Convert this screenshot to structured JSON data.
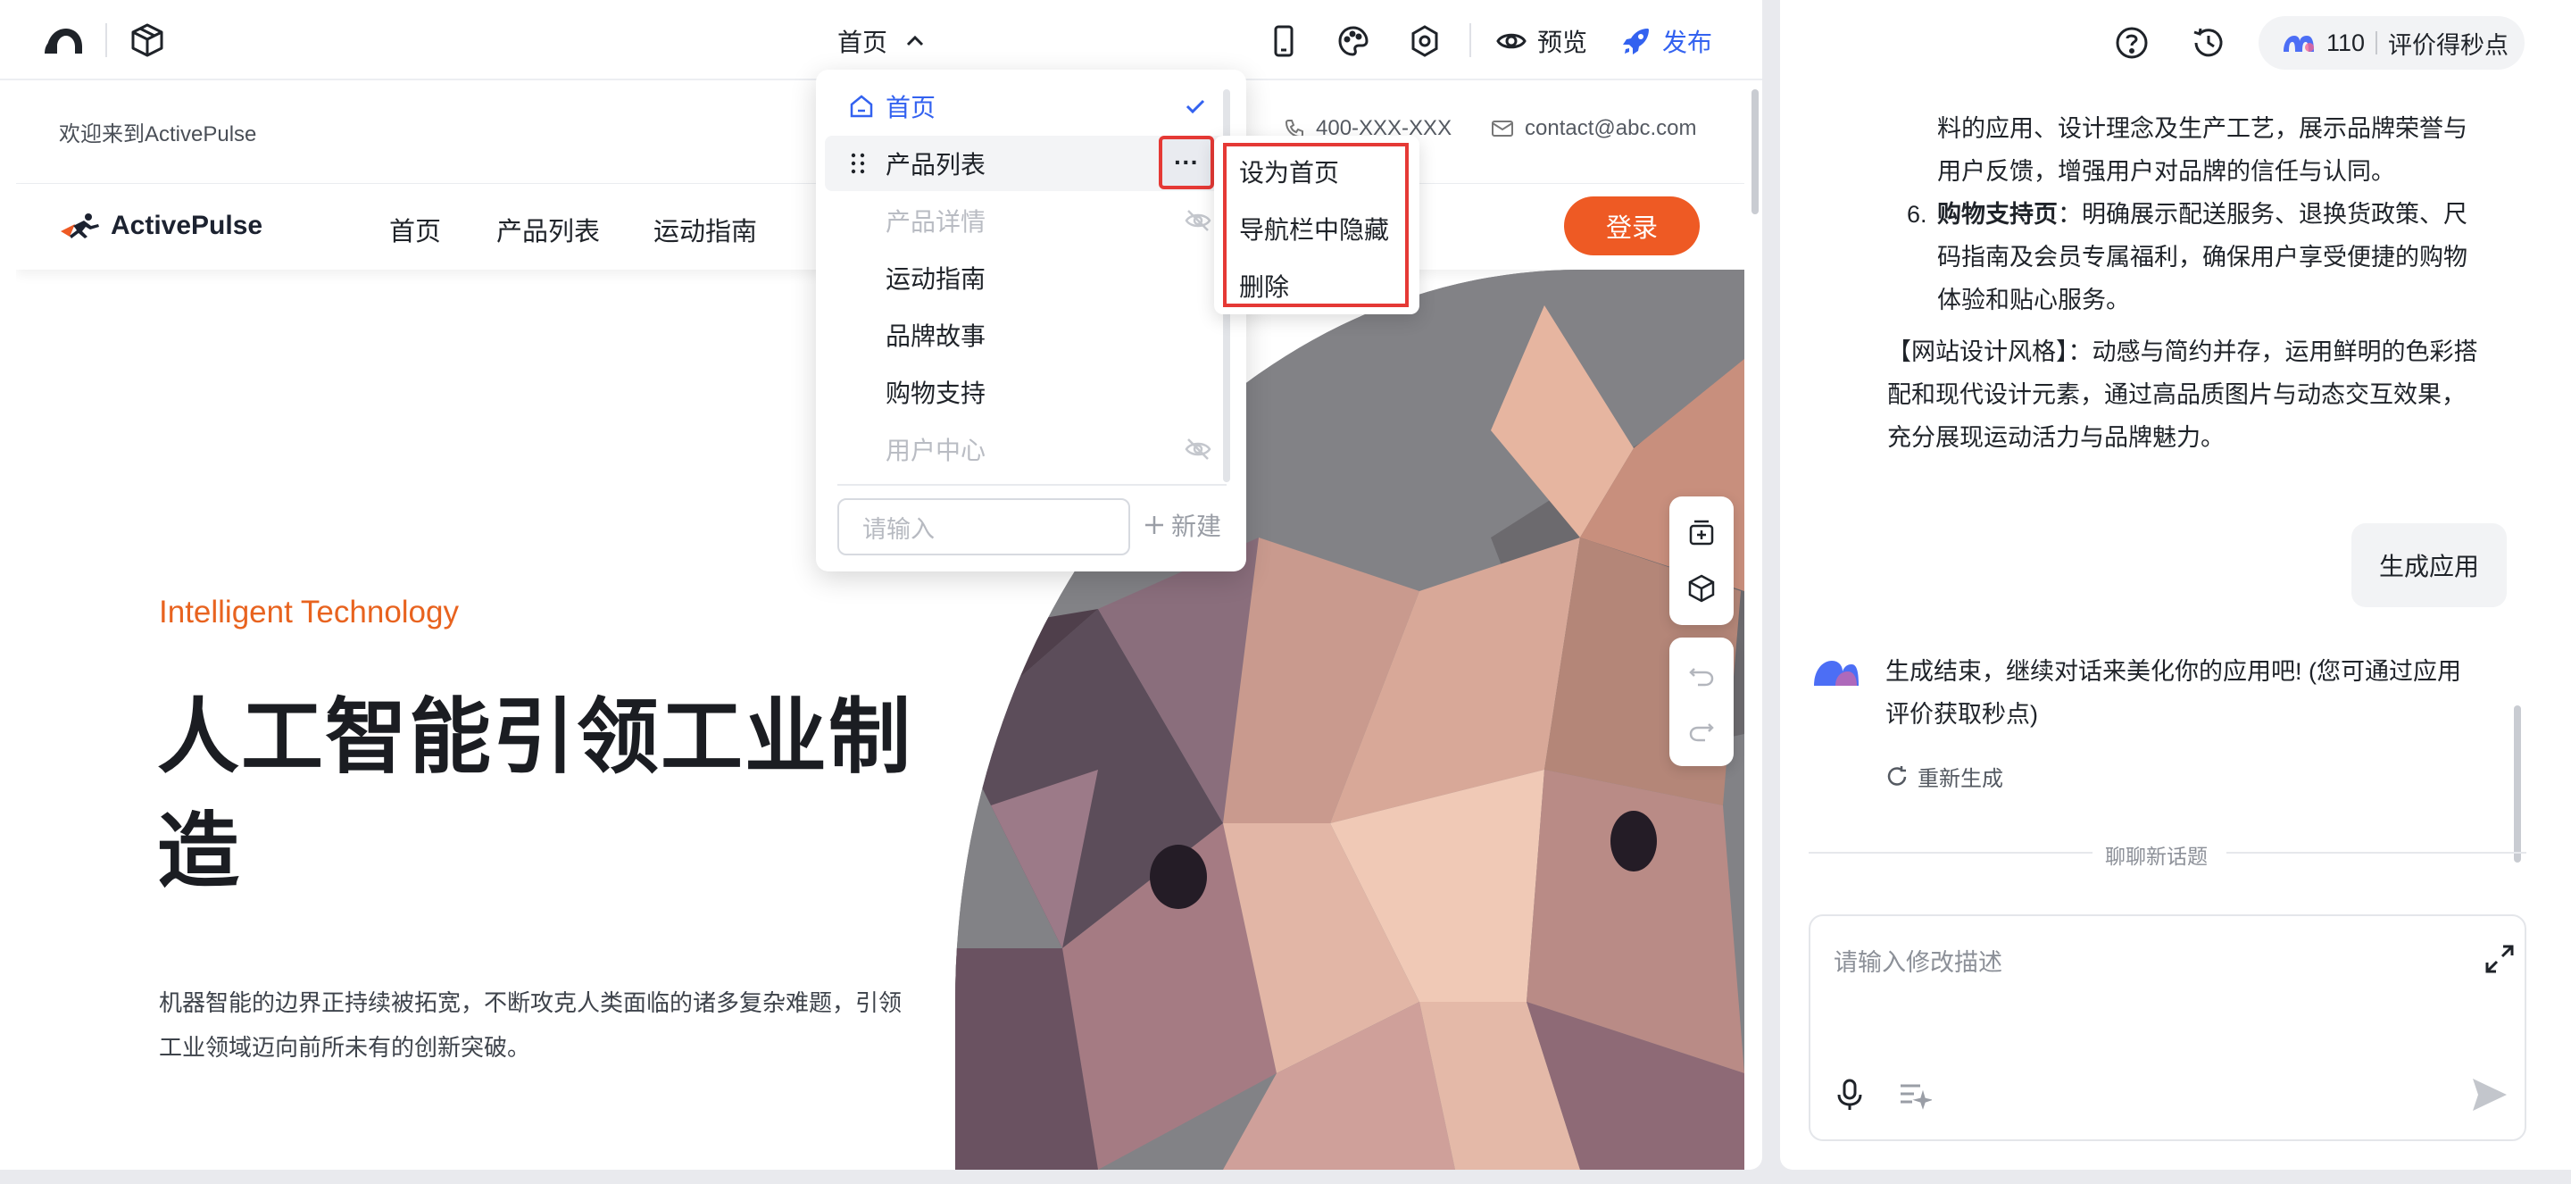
{
  "topbar": {
    "current_page": "首页",
    "preview_label": "预览",
    "publish_label": "发布"
  },
  "site": {
    "welcome": "欢迎来到ActivePulse",
    "phone": "400-XXX-XXX",
    "email": "contact@abc.com",
    "brand": "ActivePulse",
    "nav": [
      "首页",
      "产品列表",
      "运动指南"
    ],
    "login": "登录",
    "hero_tag": "Intelligent Technology",
    "hero_title": "人工智能引领工业制造",
    "hero_desc": "机器智能的边界正持续被拓宽，不断攻克人类面临的诸多复杂难题，引领工业领域迈向前所未有的创新突破。"
  },
  "page_menu": {
    "items": [
      {
        "label": "首页"
      },
      {
        "label": "产品列表"
      },
      {
        "label": "产品详情"
      },
      {
        "label": "运动指南"
      },
      {
        "label": "品牌故事"
      },
      {
        "label": "购物支持"
      },
      {
        "label": "用户中心"
      }
    ],
    "more_label": "···",
    "input_placeholder": "请输入",
    "new_label": "新建"
  },
  "context_menu": {
    "items": [
      "设为首页",
      "导航栏中隐藏",
      "删除"
    ]
  },
  "chat": {
    "credits_value": "110",
    "credits_label": "评价得秒点",
    "line1": "料的应用、设计理念及生产工艺，展示品牌荣誉与",
    "line2": "用户反馈，增强用户对品牌的信任与认同。",
    "item6_num": "6.",
    "item6_bold": "购物支持页",
    "item6_text1": "：明确展示配送服务、退换货政策、尺",
    "item6_text2": "码指南及会员专属福利，确保用户享受便捷的购物",
    "item6_text3": "体验和贴心服务。",
    "style_line1": "【网站设计风格】：动感与简约并存，运用鲜明的色彩搭",
    "style_line2": "配和现代设计元素，通过高品质图片与动态交互效果，",
    "style_line3": "充分展现运动活力与品牌魅力。",
    "user_msg": "生成应用",
    "bot_msg1": "生成结束，继续对话来美化你的应用吧! (您可通过应用",
    "bot_msg2": "评价获取秒点)",
    "regen_label": "重新生成",
    "topic_label": "聊聊新话题",
    "input_placeholder": "请输入修改描述"
  },
  "colors": {
    "accent": "#3362f0",
    "brand_orange": "#ee5a24",
    "highlight_red": "#e53935"
  }
}
